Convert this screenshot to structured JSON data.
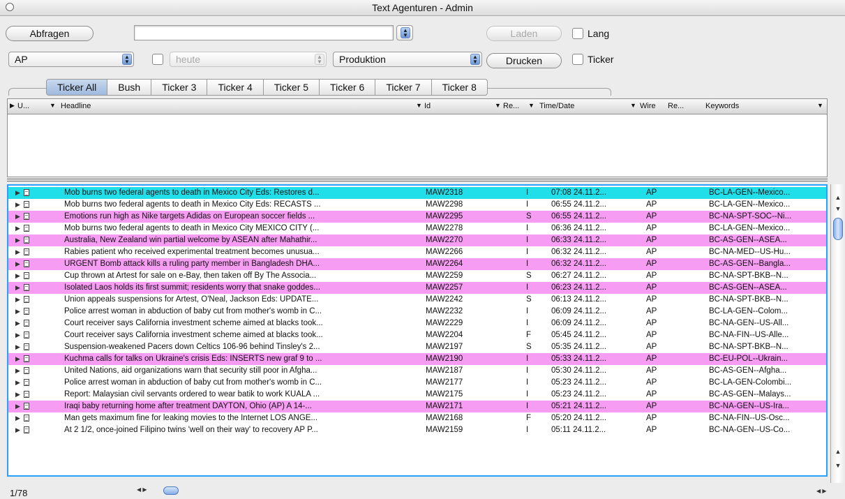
{
  "window": {
    "title": "Text Agenturen - Admin"
  },
  "toolbar": {
    "abfragen_label": "Abfragen",
    "query_value": "",
    "laden_label": "Laden",
    "lang_label": "Lang",
    "agency_value": "AP",
    "date_value": "heute",
    "mode_value": "Produktion",
    "drucken_label": "Drucken",
    "ticker_label": "Ticker"
  },
  "tabs": [
    "Ticker All",
    "Bush",
    "Ticker 3",
    "Ticker 4",
    "Ticker 5",
    "Ticker 6",
    "Ticker 7",
    "Ticker 8"
  ],
  "active_tab": "Ticker All",
  "columns": {
    "u": "U...",
    "headline": "Headline",
    "id": "Id",
    "re1": "Re...",
    "time": "Time/Date",
    "wire": "Wire",
    "re2": "Re...",
    "keywords": "Keywords"
  },
  "colors": {
    "cyan": "#21dfe9",
    "pink": "#f79cf3",
    "selection_border": "#2aa0ff"
  },
  "rows": [
    {
      "headline": "Mob burns two federal agents to death in Mexico City Eds: Restores d...",
      "id": "MAW2318",
      "re": "I",
      "time": "07:08 24.11.2...",
      "wire": "AP",
      "keywords": "BC-LA-GEN--Mexico...",
      "color": "cyan"
    },
    {
      "headline": "Mob burns two federal agents to death in Mexico City Eds: RECASTS ...",
      "id": "MAW2298",
      "re": "I",
      "time": "06:55 24.11.2...",
      "wire": "AP",
      "keywords": "BC-LA-GEN--Mexico...",
      "color": ""
    },
    {
      "headline": "Emotions run high as Nike targets Adidas on European soccer fields ...",
      "id": "MAW2295",
      "re": "S",
      "time": "06:55 24.11.2...",
      "wire": "AP",
      "keywords": "BC-NA-SPT-SOC--Ni...",
      "color": "pink"
    },
    {
      "headline": "Mob burns two federal agents to death in Mexico City MEXICO CITY (...",
      "id": "MAW2278",
      "re": "I",
      "time": "06:36 24.11.2...",
      "wire": "AP",
      "keywords": "BC-LA-GEN--Mexico...",
      "color": ""
    },
    {
      "headline": "Australia, New Zealand win partial welcome by ASEAN after Mahathir...",
      "id": "MAW2270",
      "re": "I",
      "time": "06:33 24.11.2...",
      "wire": "AP",
      "keywords": "BC-AS-GEN--ASEA...",
      "color": "pink"
    },
    {
      "headline": "Rabies patient who received experimental treatment becomes unusua...",
      "id": "MAW2266",
      "re": "I",
      "time": "06:32 24.11.2...",
      "wire": "AP",
      "keywords": "BC-NA-MED--US-Hu...",
      "color": ""
    },
    {
      "headline": "URGENT Bomb attack kills a ruling party member in Bangladesh DHA...",
      "id": "MAW2264",
      "re": "I",
      "time": "06:32 24.11.2...",
      "wire": "AP",
      "keywords": "BC-AS-GEN--Bangla...",
      "color": "pink"
    },
    {
      "headline": "Cup thrown at Artest for sale on e-Bay, then taken off By The Associa...",
      "id": "MAW2259",
      "re": "S",
      "time": "06:27 24.11.2...",
      "wire": "AP",
      "keywords": "BC-NA-SPT-BKB--N...",
      "color": ""
    },
    {
      "headline": "Isolated Laos holds its first summit; residents worry that snake goddes...",
      "id": "MAW2257",
      "re": "I",
      "time": "06:23 24.11.2...",
      "wire": "AP",
      "keywords": "BC-AS-GEN--ASEA...",
      "color": "pink"
    },
    {
      "headline": "Union appeals suspensions for Artest, O'Neal, Jackson Eds: UPDATE...",
      "id": "MAW2242",
      "re": "S",
      "time": "06:13 24.11.2...",
      "wire": "AP",
      "keywords": "BC-NA-SPT-BKB--N...",
      "color": ""
    },
    {
      "headline": "Police arrest woman in abduction of baby cut from mother's womb in C...",
      "id": "MAW2232",
      "re": "I",
      "time": "06:09 24.11.2...",
      "wire": "AP",
      "keywords": "BC-LA-GEN--Colom...",
      "color": ""
    },
    {
      "headline": "Court receiver says California investment scheme aimed at blacks took...",
      "id": "MAW2229",
      "re": "I",
      "time": "06:09 24.11.2...",
      "wire": "AP",
      "keywords": "BC-NA-GEN--US-All...",
      "color": ""
    },
    {
      "headline": "Court receiver says California investment scheme aimed at blacks took...",
      "id": "MAW2204",
      "re": "F",
      "time": "05:45 24.11.2...",
      "wire": "AP",
      "keywords": "BC-NA-FIN--US-Alle...",
      "color": ""
    },
    {
      "headline": "Suspension-weakened Pacers down Celtics 106-96 behind Tinsley's 2...",
      "id": "MAW2197",
      "re": "S",
      "time": "05:35 24.11.2...",
      "wire": "AP",
      "keywords": "BC-NA-SPT-BKB--N...",
      "color": ""
    },
    {
      "headline": "Kuchma calls for talks on Ukraine's crisis Eds: INSERTS new graf 9 to ...",
      "id": "MAW2190",
      "re": "I",
      "time": "05:33 24.11.2...",
      "wire": "AP",
      "keywords": "BC-EU-POL--Ukrain...",
      "color": "pink"
    },
    {
      "headline": "United Nations, aid organizations warn that security still poor in Afgha...",
      "id": "MAW2187",
      "re": "I",
      "time": "05:30 24.11.2...",
      "wire": "AP",
      "keywords": "BC-AS-GEN--Afgha...",
      "color": ""
    },
    {
      "headline": "Police arrest woman in abduction of baby cut from mother's womb in C...",
      "id": "MAW2177",
      "re": "I",
      "time": "05:23 24.11.2...",
      "wire": "AP",
      "keywords": "BC-LA-GEN-Colombi...",
      "color": ""
    },
    {
      "headline": "Report: Malaysian civil servants ordered to wear batik to work KUALA ...",
      "id": "MAW2175",
      "re": "I",
      "time": "05:23 24.11.2...",
      "wire": "AP",
      "keywords": "BC-AS-GEN--Malays...",
      "color": ""
    },
    {
      "headline": "Iraqi baby returning home after treatment DAYTON, Ohio (AP)   A 14-...",
      "id": "MAW2171",
      "re": "I",
      "time": "05:21 24.11.2...",
      "wire": "AP",
      "keywords": "BC-NA-GEN--US-Ira...",
      "color": "pink"
    },
    {
      "headline": "Man gets maximum fine for leaking movies to the Internet LOS ANGE...",
      "id": "MAW2168",
      "re": "F",
      "time": "05:20 24.11.2...",
      "wire": "AP",
      "keywords": "BC-NA-FIN--US-Osc...",
      "color": ""
    },
    {
      "headline": "At 2 1/2, once-joined Filipino twins 'well on their way' to recovery AP P...",
      "id": "MAW2159",
      "re": "I",
      "time": "05:11 24.11.2...",
      "wire": "AP",
      "keywords": "BC-NA-GEN--US-Co...",
      "color": ""
    }
  ],
  "status": {
    "count": "1/78"
  }
}
